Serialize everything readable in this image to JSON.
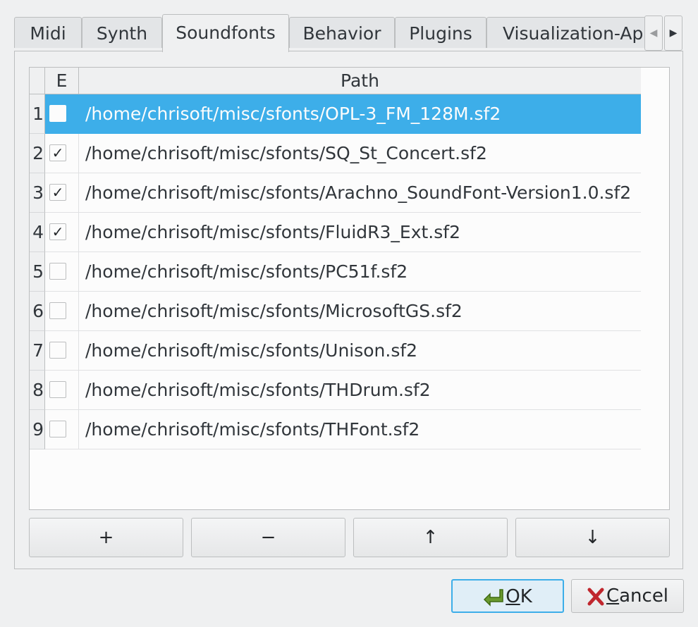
{
  "tabs": [
    {
      "label": "Midi"
    },
    {
      "label": "Synth"
    },
    {
      "label": "Soundfonts"
    },
    {
      "label": "Behavior"
    },
    {
      "label": "Plugins"
    },
    {
      "label": "Visualization-App"
    }
  ],
  "active_tab": "Soundfonts",
  "table": {
    "headers": {
      "enabled": "E",
      "path": "Path"
    },
    "rows": [
      {
        "num": "1",
        "enabled": false,
        "path": "/home/chrisoft/misc/sfonts/OPL-3_FM_128M.sf2",
        "selected": true
      },
      {
        "num": "2",
        "enabled": true,
        "path": "/home/chrisoft/misc/sfonts/SQ_St_Concert.sf2"
      },
      {
        "num": "3",
        "enabled": true,
        "path": "/home/chrisoft/misc/sfonts/Arachno_SoundFont-Version1.0.sf2"
      },
      {
        "num": "4",
        "enabled": true,
        "path": "/home/chrisoft/misc/sfonts/FluidR3_Ext.sf2"
      },
      {
        "num": "5",
        "enabled": false,
        "path": "/home/chrisoft/misc/sfonts/PC51f.sf2"
      },
      {
        "num": "6",
        "enabled": false,
        "path": "/home/chrisoft/misc/sfonts/MicrosoftGS.sf2"
      },
      {
        "num": "7",
        "enabled": false,
        "path": "/home/chrisoft/misc/sfonts/Unison.sf2"
      },
      {
        "num": "8",
        "enabled": false,
        "path": "/home/chrisoft/misc/sfonts/THDrum.sf2"
      },
      {
        "num": "9",
        "enabled": false,
        "path": "/home/chrisoft/misc/sfonts/THFont.sf2"
      }
    ]
  },
  "buttons": {
    "add": "+",
    "remove": "−",
    "up": "↑",
    "down": "↓"
  },
  "dialog": {
    "ok_mnemonic": "O",
    "ok_rest": "K",
    "cancel_mnemonic": "C",
    "cancel_rest": "ancel"
  },
  "colors": {
    "selection": "#3daee9",
    "window": "#eff0f1"
  }
}
